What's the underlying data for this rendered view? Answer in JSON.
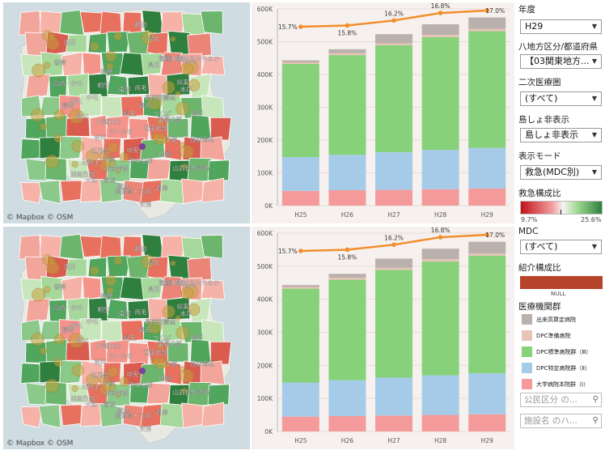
{
  "maps": {
    "attribution": "© Mapbox  © OSM",
    "labels": [
      "沼田",
      "県北",
      "吾妻",
      "県西",
      "日光",
      "高崎・安中",
      "前橋",
      "桐生",
      "太田・館林",
      "両毛",
      "県東",
      "常総",
      "秩父",
      "川越比企",
      "さいたま",
      "東葛北部",
      "千葉",
      "中央",
      "香取海匝",
      "山武長生夷隅",
      "区西部",
      "区中央部",
      "横浜",
      "横須賀・三浦",
      "君津",
      "安房",
      "足柄上",
      "湘南東部",
      "湘南西部",
      "大和・高座",
      "県南東部",
      "鹿行",
      "つくば",
      "水戸",
      "中毛",
      "西毛",
      "坂戸",
      "藤岡",
      "那須",
      "常陸太田・ひたちなか",
      "印旛",
      "東部",
      "県南",
      "県央",
      "区東北部",
      "多摩"
    ]
  },
  "chart_data": [
    {
      "type": "bar",
      "stacked": true,
      "categories": [
        "H25",
        "H26",
        "H27",
        "H28",
        "H29"
      ],
      "series": [
        {
          "name": "大学病院本院群（Ⅰ）",
          "color": "#f59a9a",
          "values": [
            45000,
            47000,
            48000,
            50000,
            52000
          ]
        },
        {
          "name": "DPC特定病院群（Ⅱ）",
          "color": "#a6cbe8",
          "values": [
            103000,
            108000,
            115000,
            120000,
            124000
          ]
        },
        {
          "name": "DPC標準病院群（Ⅲ）",
          "color": "#86d179",
          "values": [
            284000,
            304000,
            326000,
            344000,
            356000
          ]
        },
        {
          "name": "DPC準備病院",
          "color": "#e8c3b8",
          "values": [
            5000,
            6000,
            6000,
            7000,
            7000
          ]
        },
        {
          "name": "出来高算定病院",
          "color": "#bab0ac",
          "values": [
            6000,
            12000,
            28000,
            32000,
            35000
          ]
        }
      ],
      "line": {
        "name": "救急構成比",
        "color": "#f28e2b",
        "values": [
          15.7,
          15.8,
          16.2,
          16.8,
          17.0
        ],
        "labels": [
          "15.7%",
          "15.8%",
          "16.2%",
          "16.8%",
          "17.0%"
        ]
      },
      "yticks": [
        "600K",
        "500K",
        "400K",
        "300K",
        "200K",
        "100K",
        "0K"
      ],
      "ylim": [
        0,
        600000
      ]
    },
    {
      "type": "bar",
      "stacked": true,
      "categories": [
        "H25",
        "H26",
        "H27",
        "H28",
        "H29"
      ],
      "series": [
        {
          "name": "大学病院本院群（Ⅰ）",
          "color": "#f59a9a",
          "values": [
            45000,
            47000,
            48000,
            50000,
            52000
          ]
        },
        {
          "name": "DPC特定病院群（Ⅱ）",
          "color": "#a6cbe8",
          "values": [
            103000,
            108000,
            115000,
            120000,
            124000
          ]
        },
        {
          "name": "DPC標準病院群（Ⅲ）",
          "color": "#86d179",
          "values": [
            284000,
            304000,
            326000,
            344000,
            356000
          ]
        },
        {
          "name": "DPC準備病院",
          "color": "#e8c3b8",
          "values": [
            5000,
            6000,
            6000,
            7000,
            7000
          ]
        },
        {
          "name": "出来高算定病院",
          "color": "#bab0ac",
          "values": [
            6000,
            12000,
            28000,
            32000,
            35000
          ]
        }
      ],
      "line": {
        "name": "救急構成比",
        "color": "#f28e2b",
        "values": [
          15.7,
          15.8,
          16.2,
          16.8,
          17.0
        ],
        "labels": [
          "15.7%",
          "15.8%",
          "16.2%",
          "16.8%",
          "17.0%"
        ]
      },
      "yticks": [
        "600K",
        "500K",
        "400K",
        "300K",
        "200K",
        "100K",
        "0K"
      ],
      "ylim": [
        0,
        600000
      ]
    }
  ],
  "sidebar": {
    "year_label": "年度",
    "year_value": "H29",
    "region_label": "八地方区分/都道府県",
    "region_value": "【03関東地方...",
    "secondary_label": "二次医療圏",
    "secondary_value": "(すべて)",
    "island_label": "島しょ非表示",
    "island_value": "島しょ非表示",
    "mode_label": "表示モード",
    "mode_value": "救急(MDC別)",
    "ratio_label": "救急構成比",
    "ratio_min": "9.7%",
    "ratio_max": "25.6%",
    "mdc_label": "MDC",
    "mdc_value": "(すべて)",
    "intro_label": "紹介構成比",
    "intro_null": "NULL",
    "group_label": "医療機関群",
    "legend": [
      {
        "label": "出来高算定病院",
        "color": "#bab0ac"
      },
      {
        "label": "DPC準備病院",
        "color": "#e8c3b8"
      },
      {
        "label": "DPC標準病院群（Ⅲ）",
        "color": "#86d179"
      },
      {
        "label": "DPC特定病院群（Ⅱ）",
        "color": "#a6cbe8"
      },
      {
        "label": "大学病院本院群（Ⅰ）",
        "color": "#f59a9a"
      }
    ],
    "search1_placeholder": "公民区分 の...",
    "search2_placeholder": "施設名 のハ...",
    "dropdown_icon": "triangle-down-icon",
    "search_icon": "magnifier-icon",
    "intro_color": "#b5442a"
  }
}
